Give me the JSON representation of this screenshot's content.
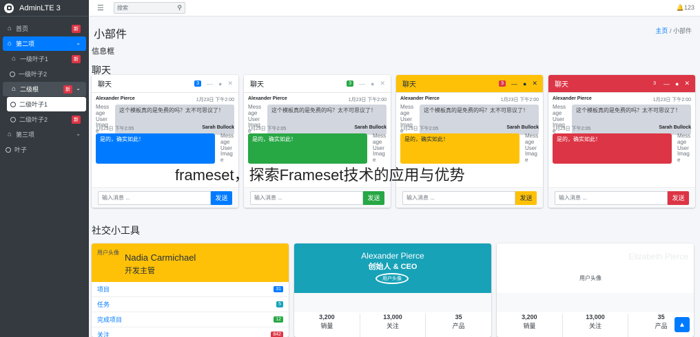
{
  "brand": {
    "name": "AdminLTE 3"
  },
  "topbar": {
    "search_placeholder": "搜索",
    "notifications": "🔔123"
  },
  "sidebar": {
    "items": [
      {
        "label": "首页",
        "badge": "新"
      },
      {
        "label": "第二项"
      },
      {
        "label": "一级叶子1",
        "badge": "新"
      },
      {
        "label": "一级叶子2"
      },
      {
        "label": "二级根",
        "badge": "新"
      },
      {
        "label": "二级叶子1"
      },
      {
        "label": "二级叶子2",
        "badge": "新"
      },
      {
        "label": "第三项"
      },
      {
        "label": "叶子"
      }
    ]
  },
  "page": {
    "title": "小部件",
    "breadcrumb_home": "主页",
    "breadcrumb_sep": "/",
    "breadcrumb_current": "小部件",
    "info_box_label": "信息框",
    "chat_section": "聊天",
    "social_section": "社交小工具",
    "overlay_title": "frameset，探索Frameset技术的应用与优势"
  },
  "chat_cards": [
    {
      "title": "聊天",
      "count": "3",
      "count_color": "#007bff",
      "accent": "#007bff",
      "header_bg": "#ffffff",
      "header_fg": "#212529"
    },
    {
      "title": "聊天",
      "count": "3",
      "count_color": "#28a745",
      "accent": "#28a745",
      "header_bg": "#ffffff",
      "header_fg": "#212529"
    },
    {
      "title": "聊天",
      "count": "3",
      "count_color": "#dc3545",
      "accent": "#ffc107",
      "header_bg": "#ffc107",
      "header_fg": "#1f2d3d"
    },
    {
      "title": "聊天",
      "count": "3",
      "count_color": "#dc3545",
      "accent": "#dc3545",
      "header_bg": "#dc3545",
      "header_fg": "#ffffff"
    }
  ],
  "chat_content": {
    "left_name": "Alexander Pierce",
    "left_time": "1月23日 下午2:00",
    "left_avatar_alt": "Message User Image",
    "left_msg": "这个模板真的是免费的吗？太不可思议了！",
    "right_name": "Sarah Bullock",
    "right_time": "1月23日 下午2:05",
    "right_avatar_alt": "Message User Image",
    "right_msg": "是的，确实如此！",
    "input_placeholder": "输入消息 ...",
    "send_label": "发送"
  },
  "widgets": {
    "w1": {
      "img_alt": "用户头像",
      "name": "Nadia Carmichael",
      "desc": "开发主管",
      "items": [
        {
          "label": "项目",
          "badge": "31",
          "color": "#007bff"
        },
        {
          "label": "任务",
          "badge": "5",
          "color": "#17a2b8"
        },
        {
          "label": "完成项目",
          "badge": "12",
          "color": "#28a745"
        },
        {
          "label": "关注",
          "badge": "842",
          "color": "#dc3545"
        }
      ]
    },
    "w2": {
      "name": "Alexander Pierce",
      "desc": "创始人 & CEO",
      "img_alt": "用户头像",
      "stats": [
        {
          "value": "3,200",
          "label": "销量"
        },
        {
          "value": "13,000",
          "label": "关注"
        },
        {
          "value": "35",
          "label": "产品"
        }
      ]
    },
    "w3": {
      "name": "Elizabeth Pierce",
      "img_alt": "用户头像",
      "stats": [
        {
          "value": "3,200",
          "label": "销量"
        },
        {
          "value": "13,000",
          "label": "关注"
        },
        {
          "value": "35",
          "label": "产品"
        }
      ]
    }
  },
  "to_top": "▲"
}
